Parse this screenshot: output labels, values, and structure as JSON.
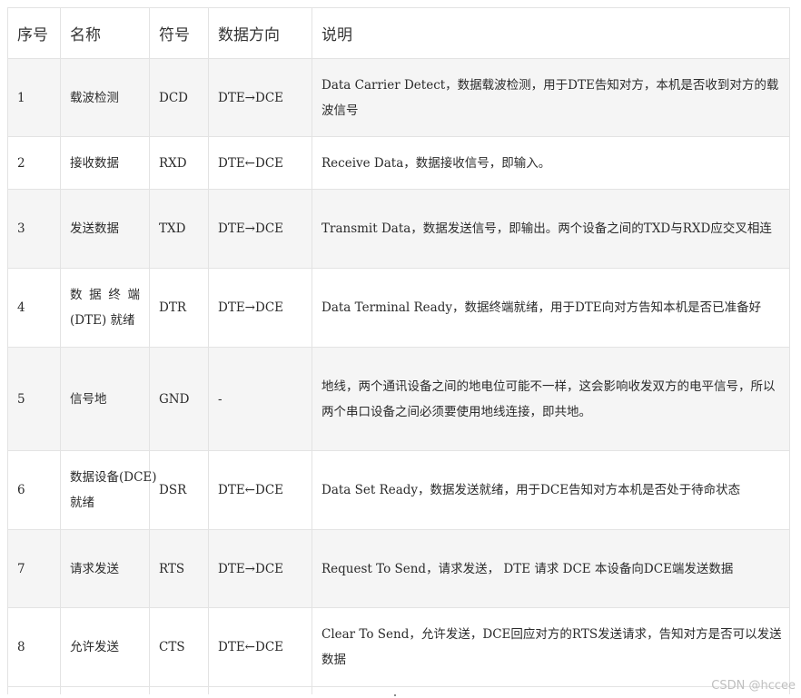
{
  "table": {
    "headers": {
      "num": "序号",
      "name": "名称",
      "symbol": "符号",
      "direction": "数据方向",
      "description": "说明"
    },
    "rows": [
      {
        "num": "1",
        "name": "载波检测",
        "symbol": "DCD",
        "direction": "DTE→DCE",
        "description": "Data Carrier Detect，数据载波检测，用于DTE告知对方，本机是否收到对方的载波信号"
      },
      {
        "num": "2",
        "name": "接收数据",
        "symbol": "RXD",
        "direction": "DTE←DCE",
        "description": "Receive Data，数据接收信号，即输入。"
      },
      {
        "num": "3",
        "name": "发送数据",
        "symbol": "TXD",
        "direction": "DTE→DCE",
        "description": "Transmit Data，数据发送信号，即输出。两个设备之间的TXD与RXD应交叉相连"
      },
      {
        "num": "4",
        "name_line1": "数据终端",
        "name_line2": "(DTE) 就绪",
        "symbol": "DTR",
        "direction": "DTE→DCE",
        "description": "Data Terminal Ready，数据终端就绪，用于DTE向对方告知本机是否已准备好"
      },
      {
        "num": "5",
        "name": "信号地",
        "symbol": "GND",
        "direction": "-",
        "description": "地线，两个通讯设备之间的地电位可能不一样，这会影响收发双方的电平信号，所以两个串口设备之间必须要使用地线连接，即共地。"
      },
      {
        "num": "6",
        "name_line1": "数据设备(DCE)",
        "name_line2": "就绪",
        "symbol": "DSR",
        "direction": "DTE←DCE",
        "description": "Data Set Ready，数据发送就绪，用于DCE告知对方本机是否处于待命状态"
      },
      {
        "num": "7",
        "name": "请求发送",
        "symbol": "RTS",
        "direction": "DTE→DCE",
        "description": "Request To Send，请求发送， DTE 请求 DCE 本设备向DCE端发送数据"
      },
      {
        "num": "8",
        "name": "允许发送",
        "symbol": "CTS",
        "direction": "DTE←DCE",
        "description": "Clear To Send，允许发送，DCE回应对方的RTS发送请求，告知对方是否可以发送数据"
      }
    ]
  },
  "watermark": "CSDN @hccee"
}
